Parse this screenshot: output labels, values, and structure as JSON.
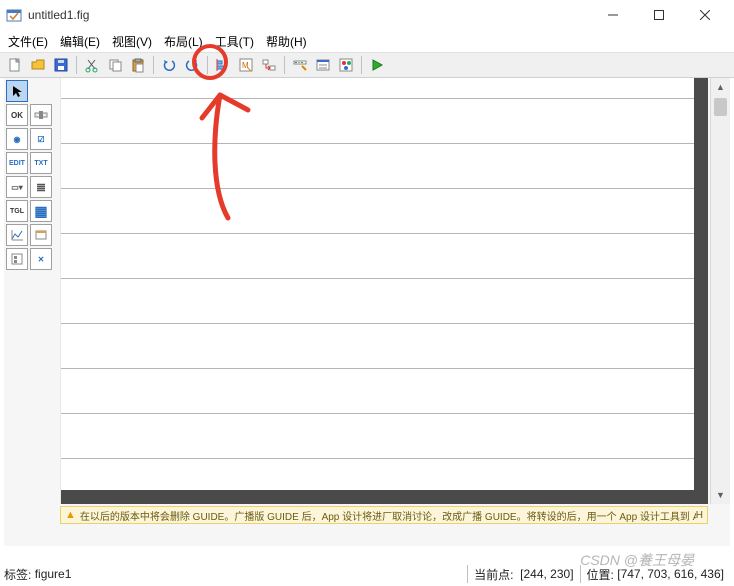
{
  "window": {
    "title": "untitled1.fig",
    "minimize_icon": "minimize",
    "maximize_icon": "maximize",
    "close_icon": "close"
  },
  "menubar": {
    "items": [
      {
        "label": "文件(E)"
      },
      {
        "label": "编辑(E)"
      },
      {
        "label": "视图(V)"
      },
      {
        "label": "布局(L)"
      },
      {
        "label": "工具(T)"
      },
      {
        "label": "帮助(H)"
      }
    ]
  },
  "toolbar": {
    "items": [
      {
        "name": "new-file",
        "icon": "file-new"
      },
      {
        "name": "open-file",
        "icon": "folder-open"
      },
      {
        "name": "save-file",
        "icon": "save"
      },
      {
        "sep": true
      },
      {
        "name": "cut",
        "icon": "cut"
      },
      {
        "name": "copy",
        "icon": "copy"
      },
      {
        "name": "paste",
        "icon": "paste"
      },
      {
        "sep": true
      },
      {
        "name": "undo",
        "icon": "undo"
      },
      {
        "name": "redo",
        "icon": "redo"
      },
      {
        "sep": true
      },
      {
        "name": "align",
        "icon": "align"
      },
      {
        "name": "m-editor",
        "icon": "m-editor"
      },
      {
        "name": "tab-order",
        "icon": "tab-order"
      },
      {
        "sep": true
      },
      {
        "name": "toolbar-editor",
        "icon": "toolbar-editor"
      },
      {
        "name": "menu-editor",
        "icon": "menu-editor"
      },
      {
        "name": "object-browser",
        "icon": "object-browser"
      },
      {
        "sep": true
      },
      {
        "name": "run",
        "icon": "play"
      }
    ]
  },
  "palette": {
    "items": [
      {
        "name": "select-tool",
        "label": "",
        "icon": "cursor",
        "selected": true
      },
      {
        "name": "push-button",
        "label": "OK"
      },
      {
        "name": "slider",
        "label": "",
        "icon": "slider"
      },
      {
        "name": "radio-button",
        "label": "◉"
      },
      {
        "name": "checkbox",
        "label": "☑"
      },
      {
        "name": "edit-text",
        "label": "EDIT"
      },
      {
        "name": "static-text",
        "label": "TXT"
      },
      {
        "name": "popup-menu",
        "label": "▭▾"
      },
      {
        "name": "listbox",
        "label": "≣"
      },
      {
        "name": "toggle-button",
        "label": "TGL"
      },
      {
        "name": "table",
        "label": "▦"
      },
      {
        "name": "axes",
        "label": "",
        "icon": "axes"
      },
      {
        "name": "panel",
        "label": "▭"
      },
      {
        "name": "button-group",
        "label": "",
        "icon": "group"
      },
      {
        "name": "activex",
        "label": "✕"
      }
    ]
  },
  "warning": {
    "text": "在以后的版本中将会删除 GUIDE。广播版 GUIDE 后，App 设计将进厂取消讨论，改成广播 GUIDE。将转设的后，用一个 App 设计工具到 App。",
    "right": "H"
  },
  "statusbar": {
    "tag_label": "标签:",
    "tag_value": "figure1",
    "current_label": "当前点:",
    "current_value": "[244, 230]",
    "position_label": "位置:",
    "position_value": "[747, 703, 616, 436]"
  },
  "watermark": "CSDN @養王母晏"
}
